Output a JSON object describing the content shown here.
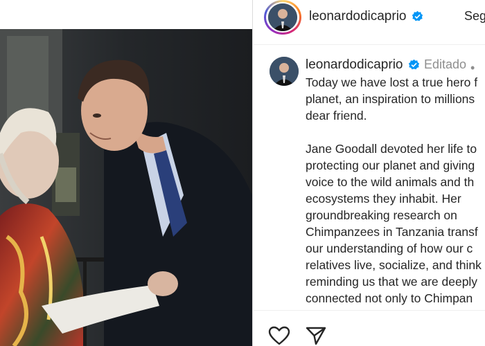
{
  "header": {
    "username": "leonardodicaprio",
    "follow_label": "Seg"
  },
  "post": {
    "username": "leonardodicaprio",
    "edited_label": "Editado",
    "separator": "•",
    "caption_paragraphs": [
      [
        "Today we have lost a true hero f",
        "planet, an inspiration to millions",
        "dear friend."
      ],
      [
        "Jane Goodall devoted her life to",
        "protecting our planet and giving",
        "voice to the wild animals and th",
        "ecosystems they inhabit. Her",
        "groundbreaking research on",
        "Chimpanzees in Tanzania transf",
        "our understanding of how our c",
        "relatives live, socialize, and think",
        "reminding us that we are deeply",
        "connected not only to Chimpan"
      ]
    ]
  },
  "actions": {
    "like_icon": "heart-icon",
    "share_icon": "paper-plane-icon"
  },
  "colors": {
    "verified": "#0095f6",
    "text": "#262626",
    "muted": "#8e8e8e"
  }
}
